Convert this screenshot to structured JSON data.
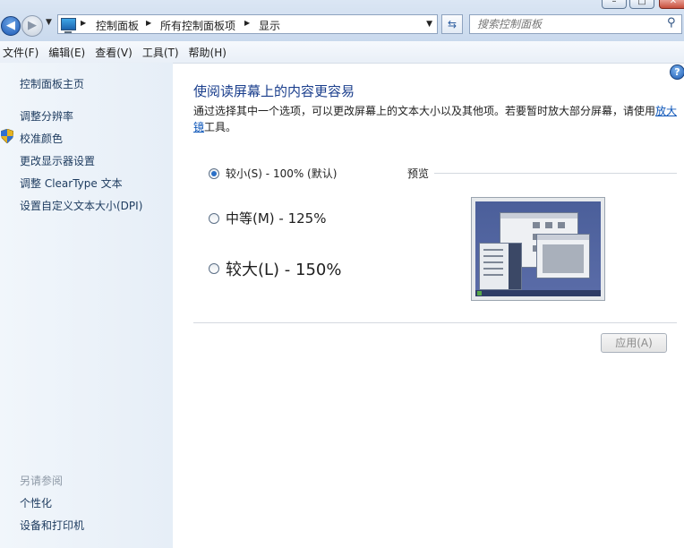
{
  "window": {
    "minimize_glyph": "–",
    "maximize_glyph": "□",
    "close_glyph": "✕"
  },
  "nav": {
    "back_glyph": "◀",
    "forward_glyph": "▶",
    "history_glyph": "▼"
  },
  "address": {
    "crumbs": [
      "控制面板",
      "所有控制面板项",
      "显示"
    ],
    "separator_glyph": "▶",
    "dropdown_glyph": "▼",
    "refresh_glyph": "⇆"
  },
  "search": {
    "placeholder": "搜索控制面板",
    "icon_glyph": "⚲"
  },
  "menu": {
    "items": [
      "文件(F)",
      "编辑(E)",
      "查看(V)",
      "工具(T)",
      "帮助(H)"
    ]
  },
  "sidebar": {
    "home": "控制面板主页",
    "links": [
      "调整分辨率",
      "校准颜色",
      "更改显示器设置",
      "调整 ClearType 文本",
      "设置自定义文本大小(DPI)"
    ],
    "see_also_heading": "另请参阅",
    "see_also": [
      "个性化",
      "设备和打印机"
    ]
  },
  "main": {
    "help_glyph": "?",
    "title": "使阅读屏幕上的内容更容易",
    "description_prefix": "通过选择其中一个选项，可以更改屏幕上的文本大小以及其他项。若要暂时放大部分屏幕，请使用",
    "description_link": "放大镜",
    "description_suffix": "工具。",
    "options": [
      {
        "label": "较小(S) - 100% (默认)",
        "selected": true
      },
      {
        "label": "中等(M) - 125%",
        "selected": false
      },
      {
        "label": "较大(L) - 150%",
        "selected": false
      }
    ],
    "preview_label": "预览",
    "apply_label": "应用(A)"
  },
  "colors": {
    "title_blue": "#1a3e8c",
    "link_blue": "#0c55b8",
    "sidebar_link": "#1c3a5e",
    "disabled_text": "#8b8b8b"
  }
}
